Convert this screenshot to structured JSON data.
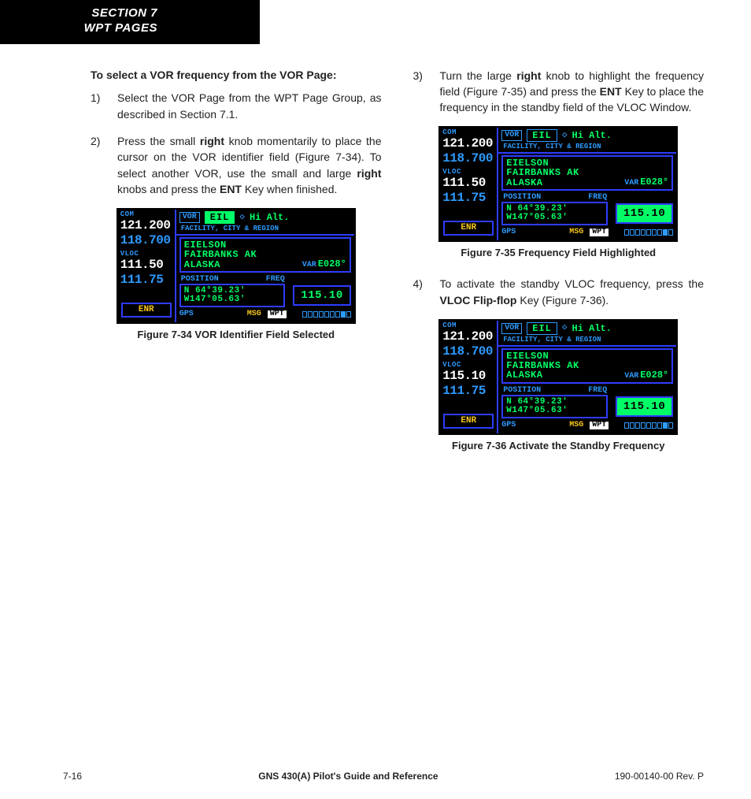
{
  "header": {
    "line1": "SECTION 7",
    "line2": "WPT PAGES"
  },
  "heading": "To select a VOR frequency from the VOR Page:",
  "steps": {
    "s1": "Select the VOR Page from the WPT Page Group, as described in Section 7.1.",
    "s2a": "Press the small ",
    "s2b": "right",
    "s2c": " knob momentarily to place the cursor on the VOR identifier field (Figure 7-34).  To select another VOR, use the small and large ",
    "s2d": "right",
    "s2e": " knobs and press the ",
    "s2f": "ENT",
    "s2g": " Key when finished.",
    "s3a": "Turn the large ",
    "s3b": "right",
    "s3c": " knob to highlight the frequency field (Figure 7-35) and press the ",
    "s3d": "ENT",
    "s3e": " Key to place the frequency in the standby field of the VLOC Window.",
    "s4a": "To activate the standby VLOC frequency, press the ",
    "s4b": "VLOC Flip-flop",
    "s4c": " Key (Figure 7-36)."
  },
  "captions": {
    "f34": "Figure 7-34  VOR Identifier Field Selected",
    "f35": "Figure 7-35  Frequency Field Highlighted",
    "f36": "Figure 7-36  Activate the Standby Frequency"
  },
  "gps": {
    "com_label": "COM",
    "vloc_label": "VLOC",
    "com_active": "121.200",
    "com_standby": "118.700",
    "vloc_active_a": "111.50",
    "vloc_standby_a": "111.75",
    "vloc_active_c": "115.10",
    "vloc_standby_c": "111.75",
    "enr": "ENR",
    "vor": "VOR",
    "ident": "EIL",
    "hialt": "Hi Alt.",
    "facility_hdr": "FACILITY, CITY & REGION",
    "facility": "EIELSON",
    "city": "FAIRBANKS AK",
    "region": "ALASKA",
    "var_lbl": "VAR",
    "var_val": "E028°",
    "pos_hdr": "POSITION",
    "freq_hdr": "FREQ",
    "lat": "N  64°39.23'",
    "lon": "W147°05.63'",
    "freq_val": "115.10",
    "gps_lbl": "GPS",
    "msg": "MSG",
    "wpt": "WPT"
  },
  "footer": {
    "left": "7-16",
    "center": "GNS 430(A) Pilot's Guide and Reference",
    "right": "190-00140-00  Rev. P"
  }
}
